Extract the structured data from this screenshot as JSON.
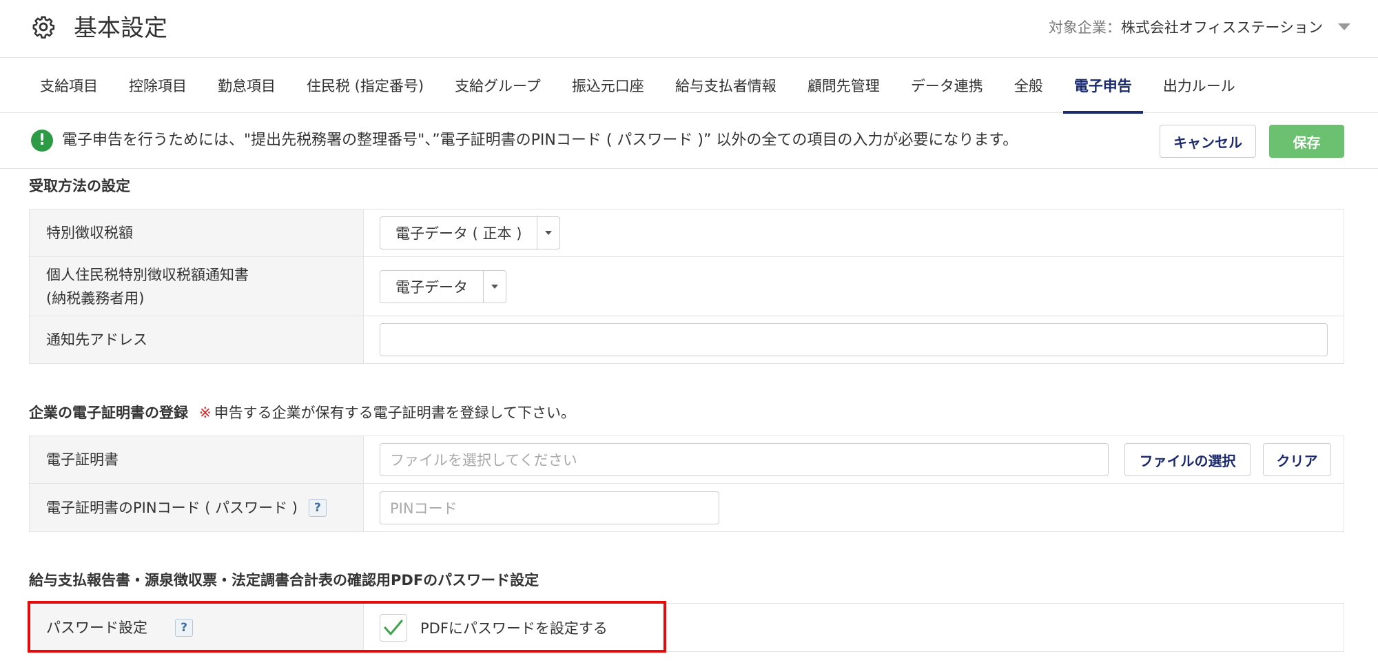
{
  "header": {
    "title": "基本設定",
    "title_icon": "gear-icon",
    "company_label": "対象企業：",
    "company_name": "株式会社オフィスステーション"
  },
  "tabs": [
    {
      "label": "支給項目",
      "active": false
    },
    {
      "label": "控除項目",
      "active": false
    },
    {
      "label": "勤怠項目",
      "active": false
    },
    {
      "label": "住民税 (指定番号)",
      "active": false
    },
    {
      "label": "支給グループ",
      "active": false
    },
    {
      "label": "振込元口座",
      "active": false
    },
    {
      "label": "給与支払者情報",
      "active": false
    },
    {
      "label": "顧問先管理",
      "active": false
    },
    {
      "label": "データ連携",
      "active": false
    },
    {
      "label": "全般",
      "active": false
    },
    {
      "label": "電子申告",
      "active": true
    },
    {
      "label": "出力ルール",
      "active": false
    }
  ],
  "notice": {
    "icon": "exclamation-icon",
    "text": "電子申告を行うためには、\"提出先税務署の整理番号\"、”電子証明書のPINコード ( パスワード )” 以外の全ての項目の入力が必要になります。",
    "cancel_label": "キャンセル",
    "save_label": "保存"
  },
  "receipt_section": {
    "title": "受取方法の設定",
    "rows": {
      "special_tax": {
        "label": "特別徴収税額",
        "value": "電子データ ( 正本 )"
      },
      "notice_doc": {
        "label_line1": "個人住民税特別徴収税額通知書",
        "label_line2": "(納税義務者用)",
        "value": "電子データ"
      },
      "address": {
        "label": "通知先アドレス",
        "value": ""
      }
    }
  },
  "cert_section": {
    "title": "企業の電子証明書の登録",
    "note_mark": "※",
    "note": "申告する企業が保有する電子証明書を登録して下さい。",
    "rows": {
      "cert": {
        "label": "電子証明書",
        "placeholder": "ファイルを選択してください",
        "select_label": "ファイルの選択",
        "clear_label": "クリア"
      },
      "pin": {
        "label": "電子証明書のPINコード ( パスワード )",
        "help": "?",
        "placeholder": "PINコード"
      }
    }
  },
  "pdf_section": {
    "title": "給与支払報告書・源泉徴収票・法定調書合計表の確認用PDFのパスワード設定",
    "rows": {
      "password": {
        "label": "パスワード設定",
        "help": "?",
        "checkbox_label": "PDFにパスワードを設定する",
        "checked": true
      }
    }
  },
  "colors": {
    "accent": "#1a2a6c",
    "save": "#6cc170",
    "notice_icon": "#2d9b46",
    "highlight": "#e30b0b"
  }
}
